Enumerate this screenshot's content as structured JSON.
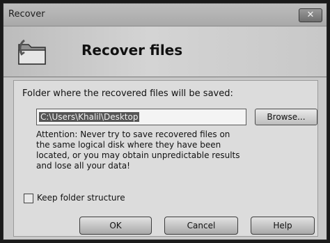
{
  "window": {
    "title": "Recover",
    "close_glyph": "✕"
  },
  "header": {
    "title": "Recover files",
    "icon": "folder-recover-icon"
  },
  "form": {
    "folder_label": "Folder where the recovered files will be saved:",
    "path_value": "C:\\Users\\Khalil\\Desktop",
    "browse_label": "Browse...",
    "attention_text": "Attention: Never try to save recovered files on the same logical disk where they have been located, or you may obtain unpredictable results and lose all your data!",
    "keep_structure_label": "Keep folder structure",
    "keep_structure_checked": false
  },
  "buttons": {
    "ok": "OK",
    "cancel": "Cancel",
    "help": "Help"
  }
}
